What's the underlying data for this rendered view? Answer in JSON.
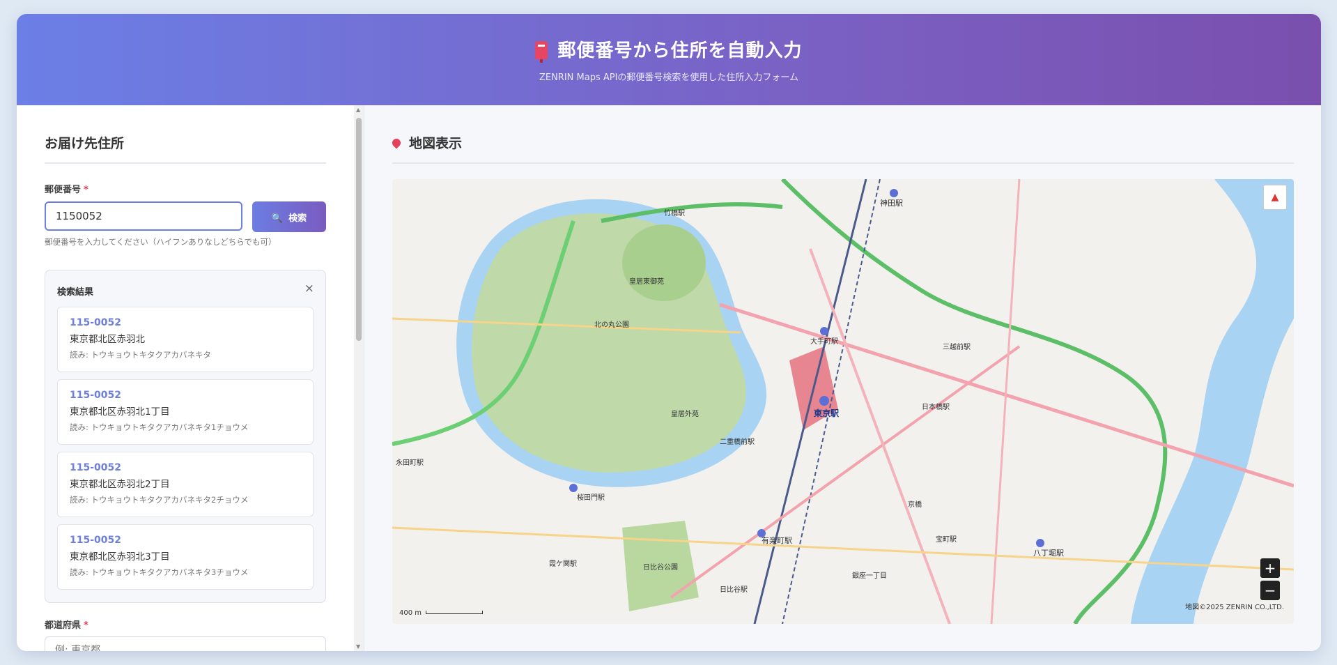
{
  "header": {
    "title": "郵便番号から住所を自動入力",
    "subtitle": "ZENRIN Maps APIの郵便番号検索を使用した住所入力フォーム"
  },
  "form": {
    "section_title": "お届け先住所",
    "zip_label": "郵便番号",
    "required_mark": "*",
    "zip_value": "1150052",
    "search_button": "検索",
    "zip_hint": "郵便番号を入力してください（ハイフンありなしどちらでも可）",
    "results": {
      "title": "検索結果",
      "close": "×",
      "items": [
        {
          "zip": "115-0052",
          "address": "東京都北区赤羽北",
          "kana": "読み: トウキョウトキタクアカバネキタ"
        },
        {
          "zip": "115-0052",
          "address": "東京都北区赤羽北1丁目",
          "kana": "読み: トウキョウトキタクアカバネキタ1チョウメ"
        },
        {
          "zip": "115-0052",
          "address": "東京都北区赤羽北2丁目",
          "kana": "読み: トウキョウトキタクアカバネキタ2チョウメ"
        },
        {
          "zip": "115-0052",
          "address": "東京都北区赤羽北3丁目",
          "kana": "読み: トウキョウトキタクアカバネキタ3チョウメ"
        }
      ]
    },
    "pref_label": "都道府県",
    "pref_placeholder": "例: 東京都"
  },
  "map": {
    "section_title": "地図表示",
    "zoom_in": "+",
    "zoom_out": "−",
    "compass": "▲",
    "scale": "400 m",
    "copyright": "地図©2025 ZENRIN CO.,LTD.",
    "labels": [
      "皇居東御苑",
      "北の丸公園",
      "皇居外苑",
      "日比谷公園",
      "東京駅",
      "大手町駅",
      "有楽町駅",
      "日比谷駅",
      "神田駅",
      "三越前駅",
      "八丁堀駅",
      "宝町駅",
      "銀座一丁目",
      "京橋",
      "桜田門駅",
      "霞ケ関駅",
      "永田町駅",
      "二重橋前駅",
      "竹橋駅",
      "日本橋駅"
    ]
  },
  "colors": {
    "header_start": "#6b7fe6",
    "header_end": "#7a4fae",
    "accent": "#6c7fe3",
    "required": "#e53950"
  }
}
